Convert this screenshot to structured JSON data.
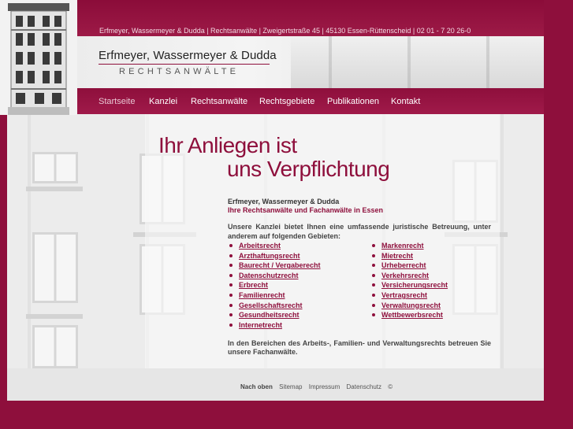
{
  "topbar": {
    "contact_line": "Erfmeyer, Wassermeyer & Dudda | Rechtsanwälte | Zweigertstraße 45 | 45130 Essen-Rüttenscheid | 02 01 - 7 20 26-0"
  },
  "logo": {
    "name": "Erfmeyer, Wassermeyer & Dudda",
    "subtitle": "RECHTSANWÄLTE"
  },
  "nav": {
    "items": [
      {
        "label": "Startseite",
        "active": true
      },
      {
        "label": "Kanzlei"
      },
      {
        "label": "Rechtsanwälte"
      },
      {
        "label": "Rechtsgebiete"
      },
      {
        "label": "Publikationen"
      },
      {
        "label": "Kontakt"
      }
    ]
  },
  "content": {
    "headline_line1": "Ihr Anliegen ist",
    "headline_line2": "uns Verpflichtung",
    "firm_name": "Erfmeyer, Wassermeyer & Dudda",
    "firm_tagline": "Ihre Rechtsanwälte und Fachanwälte in Essen",
    "intro": "Unsere Kanzlei bietet Ihnen eine umfassende juristische Betreuung, unter anderem auf folgenden Gebieten:",
    "areas_left": [
      "Arbeitsrecht",
      "Arzthaftungsrecht",
      "Baurecht / Vergaberecht",
      "Datenschutzrecht",
      "Erbrecht",
      "Familienrecht",
      "Gesellschaftsrecht",
      "Gesundheitsrecht",
      "Internetrecht"
    ],
    "areas_right": [
      "Markenrecht",
      "Mietrecht",
      "Urheberrecht",
      "Verkehrsrecht",
      "Versicherungsrecht",
      "Vertragsrecht",
      "Verwaltungsrecht",
      "Wettbewerbsrecht"
    ],
    "outro": "In den Bereichen des Arbeits-, Familien- und Verwaltungsrechts betreuen Sie unsere Fachanwälte."
  },
  "footer": {
    "links": [
      "Nach oben",
      "Sitemap",
      "Impressum",
      "Datenschutz",
      "©"
    ]
  },
  "colors": {
    "brand": "#8e0f3c",
    "background": "#ececec"
  }
}
